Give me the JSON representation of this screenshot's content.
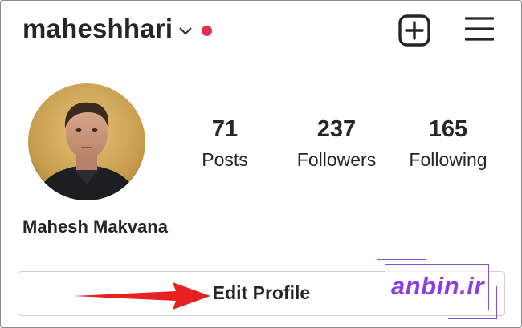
{
  "header": {
    "username": "maheshhari",
    "notification_dot_color": "#e0304e",
    "icons": [
      "chevron-down-icon",
      "new-post-icon",
      "menu-icon"
    ]
  },
  "profile": {
    "full_name": "Mahesh Makvana",
    "avatar": "profile-photo"
  },
  "stats": {
    "posts": {
      "count": "71",
      "label": "Posts"
    },
    "followers": {
      "count": "237",
      "label": "Followers"
    },
    "following": {
      "count": "165",
      "label": "Following"
    }
  },
  "actions": {
    "edit_profile_label": "Edit Profile"
  },
  "annotation": {
    "arrow_color": "#e8201f"
  },
  "watermark": {
    "text": "anbin.ir",
    "color": "#8b3fe0"
  }
}
